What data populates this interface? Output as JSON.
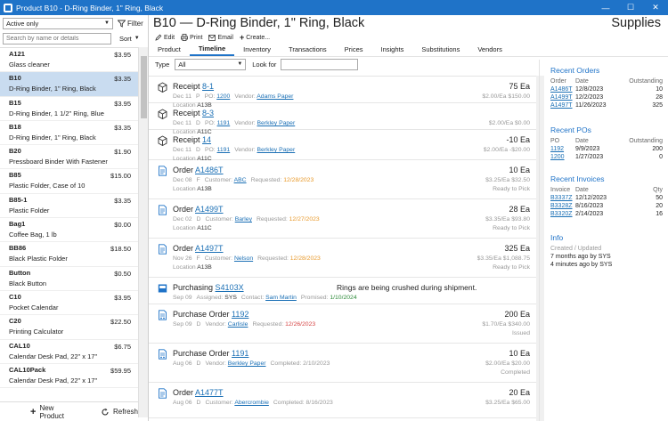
{
  "window": {
    "title": "Product B10 - D-Ring Binder, 1\" Ring, Black",
    "minimize": "—",
    "maximize": "☐",
    "close": "✕"
  },
  "left": {
    "filter_value": "Active only",
    "filter_button": "Filter",
    "search_placeholder": "Search by name or details",
    "sort_label": "Sort",
    "new_product": "New Product",
    "refresh": "Refresh",
    "products": [
      {
        "code": "A121",
        "desc": "Glass cleaner",
        "price": "$3.95"
      },
      {
        "code": "B10",
        "desc": "D-Ring Binder, 1\" Ring, Black",
        "price": "$3.35"
      },
      {
        "code": "B15",
        "desc": "D-Ring Binder, 1 1/2\" Ring, Blue",
        "price": "$3.95"
      },
      {
        "code": "B18",
        "desc": "D-Ring Binder, 1\" Ring, Black",
        "price": "$3.35"
      },
      {
        "code": "B20",
        "desc": "Pressboard Binder With Fastener",
        "price": "$1.90"
      },
      {
        "code": "B85",
        "desc": "Plastic Folder, Case of 10",
        "price": "$15.00"
      },
      {
        "code": "B85-1",
        "desc": "Plastic Folder",
        "price": "$3.35"
      },
      {
        "code": "Bag1",
        "desc": "Coffee Bag, 1 lb",
        "price": "$0.00"
      },
      {
        "code": "BB86",
        "desc": "Black Plastic Folder",
        "price": "$18.50"
      },
      {
        "code": "Button",
        "desc": "Black Button",
        "price": "$0.50"
      },
      {
        "code": "C10",
        "desc": "Pocket Calendar",
        "price": "$3.95"
      },
      {
        "code": "C20",
        "desc": "Printing Calculator",
        "price": "$22.50"
      },
      {
        "code": "CAL10",
        "desc": "Calendar Desk Pad, 22\" x 17\"",
        "price": "$6.75"
      },
      {
        "code": "CAL10Pack",
        "desc": "Calendar Desk Pad, 22\" x 17\"",
        "price": "$59.95"
      },
      {
        "code": "",
        "desc": "",
        "price": ""
      }
    ]
  },
  "header": {
    "title": "B10 — D-Ring Binder, 1\" Ring, Black",
    "app_name": "Supplies",
    "toolbar": {
      "edit": "Edit",
      "print": "Print",
      "email": "Email",
      "create": "Create..."
    }
  },
  "tabs": [
    "Product",
    "Timeline",
    "Inventory",
    "Transactions",
    "Prices",
    "Insights",
    "Substitutions",
    "Vendors"
  ],
  "active_tab": "Timeline",
  "filters": {
    "type_label": "Type",
    "type_value": "All",
    "lookfor_label": "Look for",
    "lookfor_value": ""
  },
  "timeline": [
    {
      "kind": "receipt",
      "label": "Receipt",
      "ref": "8-1",
      "qty": "75 Ea",
      "date": "Dec 11",
      "flag": "P",
      "f1_label": "PO:",
      "f1_value": "1200",
      "f2_label": "Vendor:",
      "f2_value": "Adams Paper",
      "f2_link": true,
      "right1": "$2.00/Ea  $150.00",
      "line3_label": "Location",
      "line3_value": "A13B",
      "right2": ""
    },
    {
      "kind": "receipt",
      "label": "Receipt",
      "ref": "8-3",
      "qty": "",
      "date": "Dec 11",
      "flag": "D",
      "f1_label": "PO:",
      "f1_value": "1191",
      "f2_label": "Vendor:",
      "f2_value": "Berkley Paper",
      "f2_link": true,
      "right1": "$2.00/Ea  $0.00",
      "line3_label": "Location",
      "line3_value": "A11C",
      "right2": ""
    },
    {
      "kind": "receipt",
      "label": "Receipt",
      "ref": "14",
      "qty": "-10 Ea",
      "date": "Dec 11",
      "flag": "D",
      "f1_label": "PO:",
      "f1_value": "1191",
      "f2_label": "Vendor:",
      "f2_value": "Berkley Paper",
      "f2_link": true,
      "right1": "$2.00/Ea  -$20.00",
      "line3_label": "Location",
      "line3_value": "A11C",
      "right2": ""
    },
    {
      "kind": "order",
      "label": "Order",
      "ref": "A1486T",
      "qty": "10 Ea",
      "date": "Dec 08",
      "flag": "F",
      "f1_label": "Customer:",
      "f1_value": "ABC",
      "f2_label": "Requested:",
      "f2_value": "12/28/2023",
      "f2_color": "orange",
      "right1": "$3.25/Ea  $32.50",
      "line3_label": "Location",
      "line3_value": "A13B",
      "right2": "Ready to Pick"
    },
    {
      "kind": "order",
      "label": "Order",
      "ref": "A1499T",
      "qty": "28 Ea",
      "date": "Dec 02",
      "flag": "D",
      "f1_label": "Customer:",
      "f1_value": "Barley",
      "f2_label": "Requested:",
      "f2_value": "12/27/2023",
      "f2_color": "orange",
      "right1": "$3.35/Ea  $93.80",
      "line3_label": "Location",
      "line3_value": "A11C",
      "right2": "Ready to Pick"
    },
    {
      "kind": "order",
      "label": "Order",
      "ref": "A1497T",
      "qty": "325 Ea",
      "date": "Nov 26",
      "flag": "F",
      "f1_label": "Customer:",
      "f1_value": "Nelson",
      "f2_label": "Requested:",
      "f2_value": "12/28/2023",
      "f2_color": "orange",
      "right1": "$3.35/Ea  $1,088.75",
      "line3_label": "Location",
      "line3_value": "A13B",
      "right2": "Ready to Pick"
    },
    {
      "kind": "purchasing",
      "label": "Purchasing",
      "ref": "S4103X",
      "qty": "",
      "message": "Rings are being crushed during shipment.",
      "date": "Sep 09",
      "flag": "",
      "f1_label": "Assigned:",
      "f1_value": "SYS",
      "f2_label": "Contact:",
      "f2_value": "Sam Martin",
      "f2_link": true,
      "f3_label": "Promised:",
      "f3_value": "1/10/2024",
      "f3_color": "green",
      "right1": "",
      "line3_label": "",
      "line3_value": "",
      "right2": ""
    },
    {
      "kind": "po",
      "label": "Purchase Order",
      "ref": "1192",
      "qty": "200 Ea",
      "date": "Sep 09",
      "flag": "D",
      "f1_label": "Vendor:",
      "f1_value": "Carlisle",
      "f2_label": "Requested:",
      "f2_value": "12/26/2023",
      "f2_color": "red",
      "right1": "$1.70/Ea  $340.00",
      "line3_label": "",
      "line3_value": "",
      "right2": "Issued"
    },
    {
      "kind": "po",
      "label": "Purchase Order",
      "ref": "1191",
      "qty": "10 Ea",
      "date": "Aug 06",
      "flag": "D",
      "f1_label": "Vendor:",
      "f1_value": "Berkley Paper",
      "f2_label": "Completed:",
      "f2_value": "2/10/2023",
      "right1": "$2.00/Ea  $20.00",
      "line3_label": "",
      "line3_value": "",
      "right2": "Completed"
    },
    {
      "kind": "order",
      "label": "Order",
      "ref": "A1477T",
      "qty": "20 Ea",
      "date": "Aug 06",
      "flag": "D",
      "f1_label": "Customer:",
      "f1_value": "Abercrombie",
      "f2_label": "Completed:",
      "f2_value": "8/16/2023",
      "right1": "$3.25/Ea  $65.00",
      "line3_label": "",
      "line3_value": "",
      "right2": ""
    }
  ],
  "side": {
    "recent_orders": {
      "title": "Recent Orders",
      "headers": [
        "Order",
        "Date",
        "Outstanding"
      ],
      "rows": [
        [
          "A1486T",
          "12/8/2023",
          "10"
        ],
        [
          "A1499T",
          "12/2/2023",
          "28"
        ],
        [
          "A1497T",
          "11/26/2023",
          "325"
        ]
      ]
    },
    "recent_pos": {
      "title": "Recent POs",
      "headers": [
        "PO",
        "Date",
        "Outstanding"
      ],
      "rows": [
        [
          "1192",
          "9/9/2023",
          "200"
        ],
        [
          "1200",
          "1/27/2023",
          "0"
        ]
      ]
    },
    "recent_invoices": {
      "title": "Recent Invoices",
      "headers": [
        "Invoice",
        "Date",
        "Qty"
      ],
      "rows": [
        [
          "B3337Z",
          "12/12/2023",
          "50"
        ],
        [
          "B3328Z",
          "8/16/2023",
          "20"
        ],
        [
          "B3320Z",
          "2/14/2023",
          "16"
        ]
      ]
    },
    "info": {
      "title": "Info",
      "sub": "Created / Updated",
      "created": "7 months ago by SYS",
      "updated": "4 minutes ago by SYS"
    }
  },
  "colors": {
    "accent": "#1f73c8",
    "selected_row": "#c9dcf0",
    "link": "#1a6fb5",
    "orange": "#e89a2c",
    "red": "#d64545",
    "green": "#2e8b3a"
  }
}
